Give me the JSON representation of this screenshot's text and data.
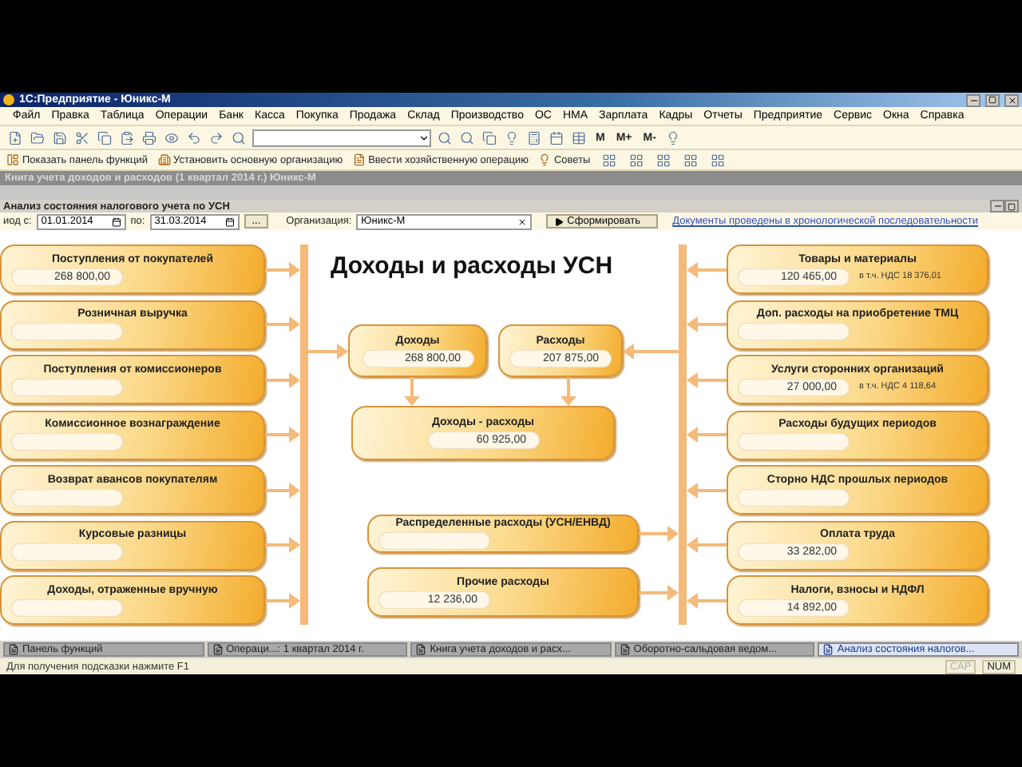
{
  "app_window": {
    "title": "1С:Предприятие - Юникс-М"
  },
  "menu": [
    "Файл",
    "Правка",
    "Таблица",
    "Операции",
    "Банк",
    "Касса",
    "Покупка",
    "Продажа",
    "Склад",
    "Производство",
    "ОС",
    "НМА",
    "Зарплата",
    "Кадры",
    "Отчеты",
    "Предприятие",
    "Сервис",
    "Окна",
    "Справка"
  ],
  "memory_buttons": [
    "M",
    "M+",
    "M-"
  ],
  "actions": [
    "Показать панель функций",
    "Установить основную организацию",
    "Ввести хозяйственную операцию",
    "Советы"
  ],
  "background_window": {
    "title": "Книга учета доходов и расходов (1 квартал 2014 г.) Юникс-М"
  },
  "form": {
    "title": "Анализ состояния налогового учета по УСН",
    "filters": {
      "from_label": "иод с:",
      "from": "01.01.2014",
      "to_label": "по:",
      "to": "31.03.2014",
      "period_button": "...",
      "org_label": "Организация:",
      "org": "Юникс-М",
      "run_button": "Сформировать",
      "link": "Документы проведены в хронологической последовательности"
    },
    "diagram": {
      "title": "Доходы и расходы УСН",
      "income_items": [
        {
          "label": "Поступления от покупателей",
          "value": "268 800,00"
        },
        {
          "label": "Розничная выручка"
        },
        {
          "label": "Поступления от комиссионеров"
        },
        {
          "label": "Комиссионное вознаграждение"
        },
        {
          "label": "Возврат авансов покупателям"
        },
        {
          "label": "Курсовые разницы"
        },
        {
          "label": "Доходы, отраженные вручную"
        }
      ],
      "expense_items": [
        {
          "label": "Товары и материалы",
          "value": "120 465,00",
          "note": "в т.ч. НДС 18 376,01"
        },
        {
          "label": "Доп. расходы на приобретение ТМЦ"
        },
        {
          "label": "Услуги сторонних организаций",
          "value": "27 000,00",
          "note": "в т.ч. НДС 4 118,64"
        },
        {
          "label": "Расходы будущих периодов"
        },
        {
          "label": "Сторно НДС прошлых периодов"
        },
        {
          "label": "Оплата труда",
          "value": "33 282,00"
        },
        {
          "label": "Налоги, взносы и НДФЛ",
          "value": "14 892,00"
        }
      ],
      "income_total": {
        "label": "Доходы",
        "value": "268 800,00"
      },
      "expense_total": {
        "label": "Расходы",
        "value": "207 875,00"
      },
      "result": {
        "label": "Доходы - расходы",
        "value": "60 925,00"
      },
      "distributed": {
        "label": "Распределенные расходы (УСН/ЕНВД)"
      },
      "other": {
        "label": "Прочие расходы",
        "value": "12 236,00"
      }
    }
  },
  "taskbar": [
    {
      "label": "Панель функций",
      "selected": false
    },
    {
      "label": "Операци...: 1 квартал 2014 г.",
      "selected": false
    },
    {
      "label": "Книга учета доходов и расх...",
      "selected": false
    },
    {
      "label": "Оборотно-сальдовая ведом...",
      "selected": false
    },
    {
      "label": "Анализ состояния налогов...",
      "selected": true
    }
  ],
  "status_bar": {
    "hint": "Для получения подсказки нажмите F1",
    "indicators": [
      {
        "label": "CAP",
        "on": false
      },
      {
        "label": "NUM",
        "on": true
      }
    ]
  }
}
